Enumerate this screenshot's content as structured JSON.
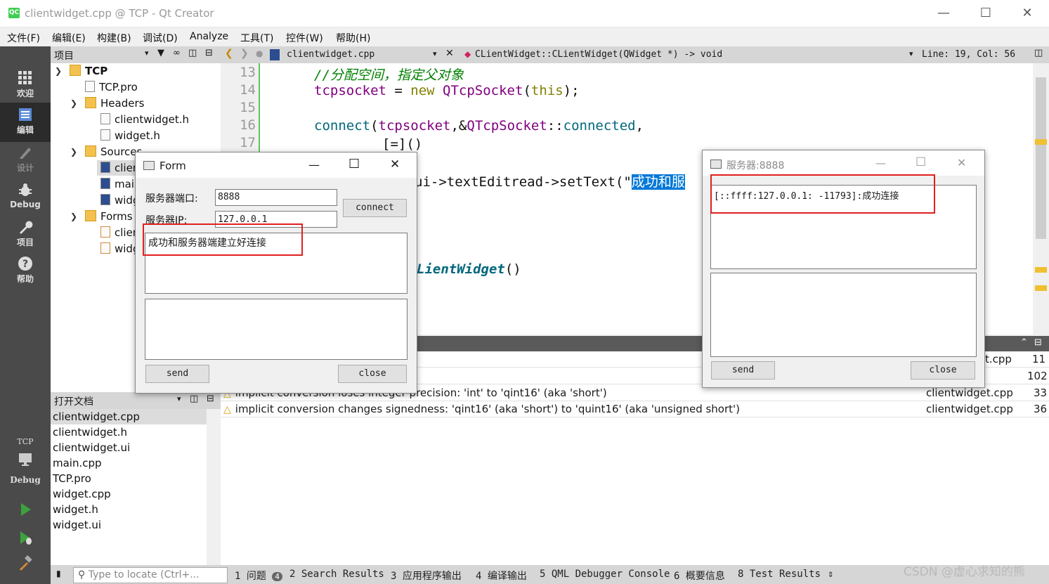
{
  "window": {
    "title": "clientwidget.cpp @ TCP - Qt Creator",
    "app_icon": "QC"
  },
  "menu": [
    "文件(F)",
    "编辑(E)",
    "构建(B)",
    "调试(D)",
    "Analyze",
    "工具(T)",
    "控件(W)",
    "帮助(H)"
  ],
  "modes": [
    {
      "label": "欢迎",
      "icon": "grid-icon"
    },
    {
      "label": "编辑",
      "icon": "edit-icon"
    },
    {
      "label": "设计",
      "icon": "pencil-icon"
    },
    {
      "label": "Debug",
      "icon": "bug-icon"
    },
    {
      "label": "项目",
      "icon": "wrench-icon"
    },
    {
      "label": "帮助",
      "icon": "help-icon"
    }
  ],
  "kit": {
    "project": "TCP",
    "config": "Debug"
  },
  "project_pane": {
    "title": "项目",
    "root": "TCP",
    "items": {
      "pro": "TCP.pro",
      "headers": "Headers",
      "h1": "clientwidget.h",
      "h2": "widget.h",
      "sources": "Sources",
      "s1": "clientwidget.cpp",
      "s2": "main.cpp",
      "s3": "widget.cpp",
      "forms": "Forms",
      "f1": "clientwidget.ui",
      "f2": "widget.ui"
    }
  },
  "open_docs": {
    "title": "打开文档",
    "items": [
      "clientwidget.cpp",
      "clientwidget.h",
      "clientwidget.ui",
      "main.cpp",
      "TCP.pro",
      "widget.cpp",
      "widget.h",
      "widget.ui"
    ]
  },
  "editor_toolbar": {
    "file": "clientwidget.cpp",
    "symbol": "CLientWidget::CLientWidget(QWidget *) -> void",
    "position": "Line: 19, Col: 56"
  },
  "code": {
    "line_numbers": [
      "13",
      "14",
      "15",
      "16",
      "17"
    ],
    "l13": "//分配空间，指定父对象",
    "l14a": "tcpsocket",
    "l14b": " = ",
    "l14c": "new",
    "l14d": " QTcpSocket",
    "l14e": "(",
    "l14f": "this",
    "l14g": ");",
    "l16a": "connect",
    "l16b": "(",
    "l16c": "tcpsocket",
    "l16d": ",&",
    "l16e": "QTcpSocket",
    "l16f": "::",
    "l16g": "connected",
    "l16h": ",",
    "l17": "[=]()",
    "l19a": "ui->textEditread->setText(\"",
    "l19sel": "成功和服",
    "l24a": "LientWidget",
    "l24b": "()"
  },
  "issues": [
    {
      "text": "implicit conversion loses integer precision: 'int' to 'qint16' (aka 'short')",
      "file": "clientwidget.cpp",
      "line": "33"
    },
    {
      "text": "implicit conversion changes signedness: 'qint16' (aka 'short') to 'quint16' (aka 'unsigned short')",
      "file": "clientwidget.cpp",
      "line": "36"
    }
  ],
  "issues_partial": [
    {
      "file": "t.cpp",
      "line": "11"
    },
    {
      "file": "",
      "line": "102"
    }
  ],
  "status_bar": {
    "locate_placeholder": "Type to locate (Ctrl+...",
    "issues_label": "1 问题",
    "issues_count": "4",
    "tabs": [
      "2 Search Results",
      "3 应用程序输出",
      "4 编译输出",
      "5 QML Debugger Console",
      "6 概要信息",
      "8 Test Results"
    ]
  },
  "watermark": "CSDN @虚心求知的熊",
  "client_dialog": {
    "title": "Form",
    "port_label": "服务器端口:",
    "port_value": "8888",
    "ip_label": "服务器IP:",
    "ip_value": "127.0.0.1",
    "connect_label": "connect",
    "read_text": "成功和服务器端建立好连接",
    "send_label": "send",
    "close_label": "close"
  },
  "server_dialog": {
    "title": "服务器:8888",
    "read_text": "[::ffff:127.0.0.1: -11793]:成功连接",
    "send_label": "send",
    "close_label": "close"
  },
  "colors": {
    "highlight": "#e02020",
    "selection": "#0078d7",
    "gutter_marker": "#5ec65e"
  }
}
